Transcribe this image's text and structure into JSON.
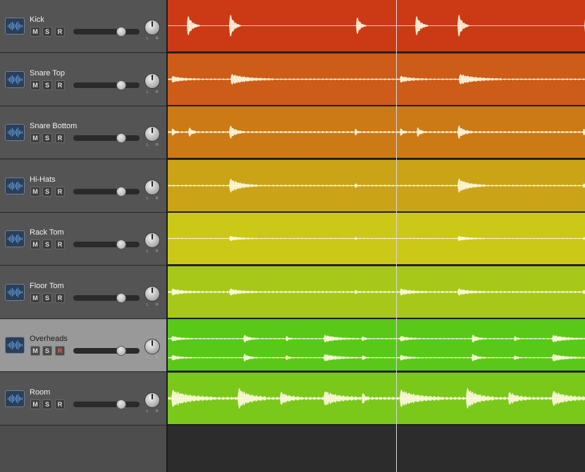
{
  "tracks": [
    {
      "name": "Kick",
      "color": "#cb3a14",
      "volume": 0.72,
      "selected": false,
      "stereo": false,
      "hits": [
        [
          28,
          0.6,
          18
        ],
        [
          88,
          0.7,
          16
        ],
        [
          268,
          0.55,
          14
        ],
        [
          448,
          0.55,
          14
        ]
      ],
      "noise": 0.0
    },
    {
      "name": "Snare Top",
      "color": "#cc5c18",
      "volume": 0.72,
      "selected": false,
      "stereo": false,
      "hits": [
        [
          6,
          0.15,
          40
        ],
        [
          90,
          0.25,
          60
        ],
        [
          328,
          0.5,
          50
        ],
        [
          448,
          0.1,
          8
        ]
      ],
      "noise": 0.05
    },
    {
      "name": "Snare Bottom",
      "color": "#cc7a16",
      "volume": 0.72,
      "selected": false,
      "stereo": false,
      "hits": [
        [
          6,
          0.2,
          10
        ],
        [
          30,
          0.25,
          12
        ],
        [
          88,
          0.35,
          20
        ],
        [
          266,
          0.2,
          6
        ],
        [
          328,
          0.55,
          40
        ],
        [
          448,
          0.25,
          8
        ]
      ],
      "noise": 0.06
    },
    {
      "name": "Hi-Hats",
      "color": "#cba316",
      "volume": 0.72,
      "selected": false,
      "stereo": false,
      "hits": [
        [
          88,
          0.35,
          40
        ],
        [
          266,
          0.12,
          6
        ],
        [
          328,
          0.3,
          14
        ],
        [
          448,
          0.12,
          6
        ]
      ],
      "noise": 0.05
    },
    {
      "name": "Rack Tom",
      "color": "#cbc818",
      "volume": 0.72,
      "selected": false,
      "stereo": false,
      "hits": [
        [
          88,
          0.12,
          40
        ],
        [
          266,
          0.08,
          6
        ],
        [
          328,
          0.1,
          8
        ],
        [
          448,
          0.06,
          6
        ]
      ],
      "noise": 0.03
    },
    {
      "name": "Floor Tom",
      "color": "#a7c818",
      "volume": 0.72,
      "selected": false,
      "stereo": false,
      "hits": [
        [
          6,
          0.15,
          40
        ],
        [
          88,
          0.15,
          40
        ],
        [
          266,
          0.1,
          6
        ],
        [
          328,
          0.12,
          30
        ],
        [
          448,
          0.1,
          8
        ]
      ],
      "noise": 0.06
    },
    {
      "name": "Overheads",
      "color": "#5ac818",
      "volume": 0.72,
      "selected": true,
      "stereo": true,
      "hits": [
        [
          6,
          0.3,
          30
        ],
        [
          108,
          0.45,
          20
        ],
        [
          168,
          0.3,
          10
        ],
        [
          222,
          0.4,
          50
        ],
        [
          276,
          0.3,
          10
        ],
        [
          330,
          0.35,
          30
        ],
        [
          388,
          0.25,
          10
        ],
        [
          460,
          0.5,
          14
        ],
        [
          500,
          0.3,
          14
        ]
      ],
      "noise": 0.08
    },
    {
      "name": "Room",
      "color": "#7ac81a",
      "volume": 0.72,
      "selected": false,
      "stereo": false,
      "hits": [
        [
          6,
          0.4,
          60
        ],
        [
          100,
          0.5,
          40
        ],
        [
          160,
          0.3,
          30
        ],
        [
          222,
          0.35,
          50
        ],
        [
          276,
          0.3,
          10
        ],
        [
          330,
          0.5,
          50
        ],
        [
          388,
          0.35,
          30
        ],
        [
          458,
          0.45,
          30
        ],
        [
          500,
          0.3,
          20
        ]
      ],
      "noise": 0.1
    }
  ],
  "labels": {
    "mute": "M",
    "solo": "S",
    "record": "R",
    "pan_left": "L",
    "pan_right": "R"
  },
  "playhead_fraction": 0.548
}
